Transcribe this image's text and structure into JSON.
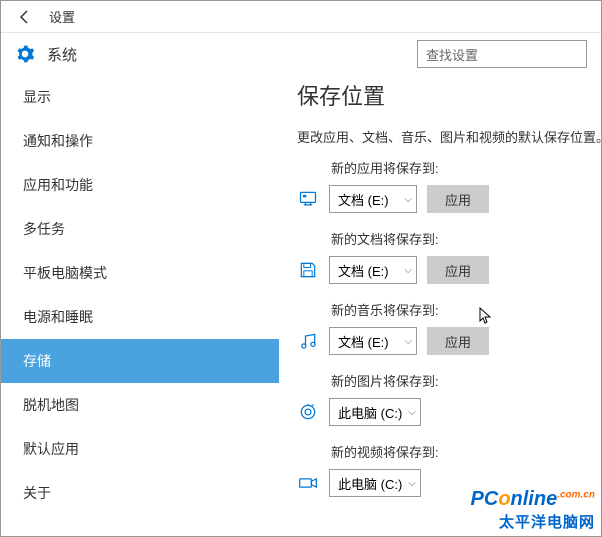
{
  "window": {
    "title": "设置",
    "header": "系统",
    "search_placeholder": "查找设置"
  },
  "sidebar": {
    "items": [
      {
        "label": "显示"
      },
      {
        "label": "通知和操作"
      },
      {
        "label": "应用和功能"
      },
      {
        "label": "多任务"
      },
      {
        "label": "平板电脑模式"
      },
      {
        "label": "电源和睡眠"
      },
      {
        "label": "存储"
      },
      {
        "label": "脱机地图"
      },
      {
        "label": "默认应用"
      },
      {
        "label": "关于"
      }
    ],
    "active_index": 6
  },
  "main": {
    "heading": "保存位置",
    "description": "更改应用、文档、音乐、图片和视频的默认保存位置。",
    "apply_label": "应用",
    "settings": [
      {
        "label": "新的应用将保存到:",
        "value": "文档 (E:)",
        "icon": "monitor-icon",
        "show_apply": true
      },
      {
        "label": "新的文档将保存到:",
        "value": "文档 (E:)",
        "icon": "save-icon",
        "show_apply": true
      },
      {
        "label": "新的音乐将保存到:",
        "value": "文档 (E:)",
        "icon": "music-icon",
        "show_apply": true
      },
      {
        "label": "新的图片将保存到:",
        "value": "此电脑 (C:)",
        "icon": "camera-icon",
        "show_apply": false
      },
      {
        "label": "新的视频将保存到:",
        "value": "此电脑 (C:)",
        "icon": "video-icon",
        "show_apply": false
      }
    ]
  },
  "watermark": {
    "line1": "PConline.com.cn",
    "line2": "太平洋电脑网"
  }
}
